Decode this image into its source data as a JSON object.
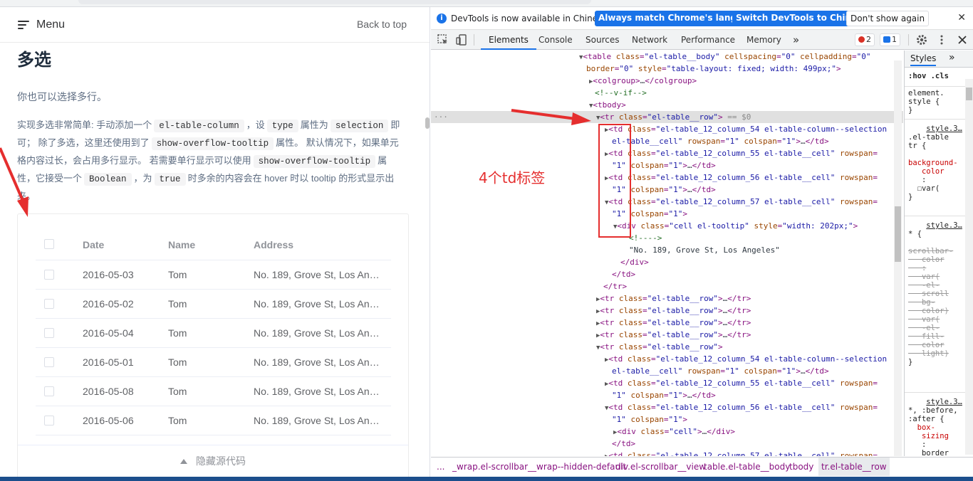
{
  "docs": {
    "menu_label": "Menu",
    "back_to_top": "Back to top",
    "title": "多选",
    "para1": "你也可以选择多行。",
    "para2": {
      "s1": "实现多选非常简单: 手动添加一个",
      "code1": "el-table-column",
      "s2": "，设",
      "code2": "type",
      "s3": "属性为",
      "code3": "selection",
      "s4": "即可； 除了多选，这里还使用到了",
      "code4": "show-overflow-tooltip",
      "s5": "属性。 默认情况下，如果单元格内容过长，会占用多行显示。 若需要单行显示可以使用",
      "code5": "show-overflow-tooltip",
      "s6": "属性，它接受一个",
      "code6": "Boolean",
      "s7": "，为",
      "code7": "true",
      "s8": "时多余的内容会在 hover 时以 tooltip 的形式显示出来。"
    },
    "table": {
      "headers": {
        "date": "Date",
        "name": "Name",
        "address": "Address"
      },
      "rows": [
        {
          "date": "2016-05-03",
          "name": "Tom",
          "address": "No. 189, Grove St, Los Angeles"
        },
        {
          "date": "2016-05-02",
          "name": "Tom",
          "address": "No. 189, Grove St, Los Angeles"
        },
        {
          "date": "2016-05-04",
          "name": "Tom",
          "address": "No. 189, Grove St, Los Angeles"
        },
        {
          "date": "2016-05-01",
          "name": "Tom",
          "address": "No. 189, Grove St, Los Angeles"
        },
        {
          "date": "2016-05-08",
          "name": "Tom",
          "address": "No. 189, Grove St, Los Angeles"
        },
        {
          "date": "2016-05-06",
          "name": "Tom",
          "address": "No. 189, Grove St, Los Angeles"
        }
      ]
    },
    "hide_code": "隐藏源代码"
  },
  "devtools": {
    "info_text": "DevTools is now available in Chinese!",
    "btn_match": "Always match Chrome's language",
    "btn_switch": "Switch DevTools to Chinese",
    "btn_dont": "Don't show again",
    "tabs": [
      "Elements",
      "Console",
      "Sources",
      "Network",
      "Performance",
      "Memory"
    ],
    "more_tabs": "»",
    "error_count": "2",
    "message_count": "1",
    "styles_tab": "Styles",
    "breadcrumbs": [
      "...",
      "_wrap.el-scrollbar__wrap--hidden-default",
      "div.el-scrollbar__view",
      "table.el-table__body",
      "tbody",
      "tr.el-table__row"
    ]
  },
  "annotation": {
    "text": "4个td标签"
  },
  "colors": {
    "accent": "#1a73e8",
    "annotation_red": "#e52e2e",
    "element_primary": "#409eff"
  },
  "icons": [
    "hamburger-icon",
    "info-icon",
    "inspect-icon",
    "device-icon",
    "gear-icon",
    "kebab-icon",
    "close-icon",
    "checkbox-icon",
    "caret-up-icon"
  ]
}
